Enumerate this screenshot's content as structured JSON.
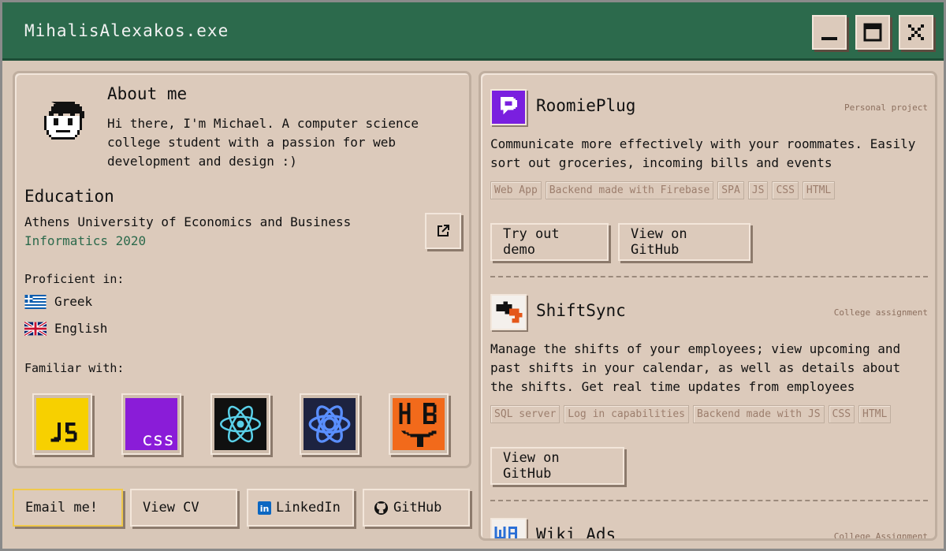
{
  "window": {
    "title": "MihalisAlexakos.exe",
    "colors": {
      "titlebar": "#2c6a4c",
      "panel": "#dccabb",
      "accent_text": "#2c6a4c"
    }
  },
  "about": {
    "heading": "About me",
    "text": "Hi there, I'm Michael. A computer science college student with a passion for web development and design :)"
  },
  "education": {
    "heading": "Education",
    "university": "Athens University of Economics and Business",
    "major": "Informatics 2020"
  },
  "proficient": {
    "heading": "Proficient in:",
    "languages": [
      {
        "name": "Greek",
        "icon": "greece-flag-icon"
      },
      {
        "name": "English",
        "icon": "uk-flag-icon"
      }
    ]
  },
  "familiar": {
    "heading": "Familiar with:",
    "skills": [
      "javascript-icon",
      "css-icon",
      "react-icon",
      "electron-icon",
      "handlebars-icon"
    ]
  },
  "footer": {
    "email": "Email me!",
    "cv": "View CV",
    "linkedin": "LinkedIn",
    "github": "GitHub"
  },
  "projects": [
    {
      "name": "RoomiePlug",
      "type": "Personal project",
      "description": "Communicate more effectively with your roommates. Easily sort out groceries, incoming bills and events",
      "tags": [
        "Web App",
        "Backend made with Firebase",
        "SPA",
        "JS",
        "CSS",
        "HTML"
      ],
      "buttons": [
        "Try out demo",
        "View on GitHub"
      ]
    },
    {
      "name": "ShiftSync",
      "type": "College assignment",
      "description": "Manage the shifts of your employees; view upcoming and past shifts in your calendar, as well as details about the shifts. Get real time updates from employees",
      "tags": [
        "SQL server",
        "Log in capabilities",
        "Backend made with JS",
        "CSS",
        "HTML"
      ],
      "buttons": [
        "View on GitHub"
      ]
    },
    {
      "name": "Wiki Ads",
      "type": "College Assignment"
    }
  ]
}
